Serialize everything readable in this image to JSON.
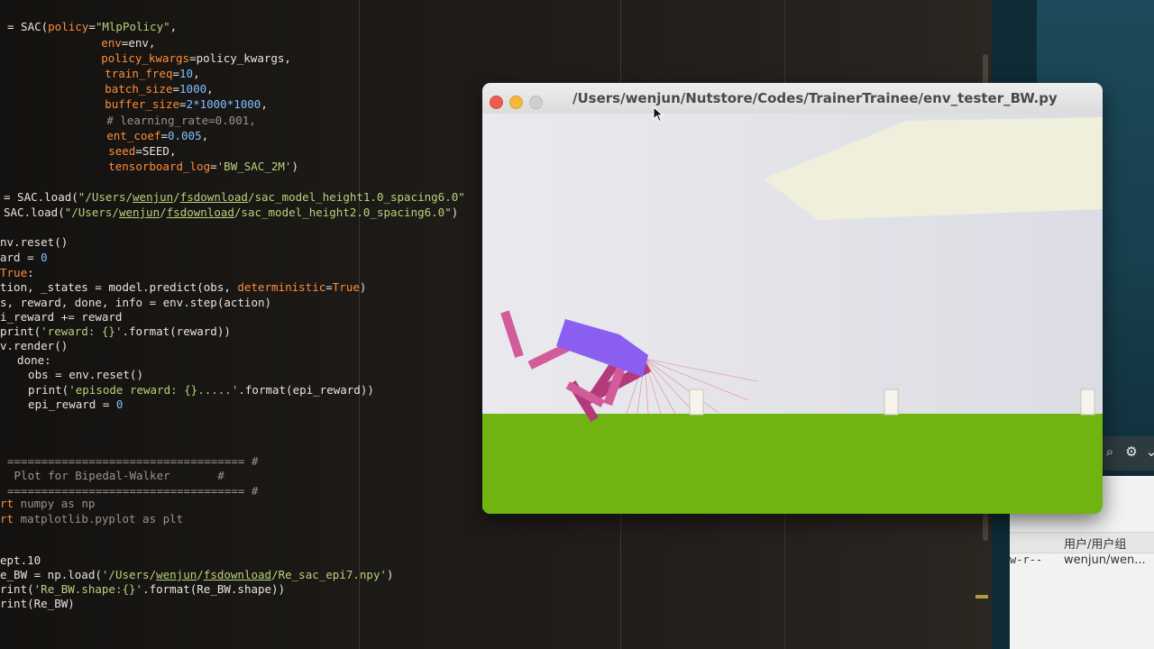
{
  "editor": {
    "lines": [
      [
        [
          "",
          "= SAC("
        ],
        [
          "k",
          "policy"
        ],
        [
          "",
          "="
        ],
        [
          "s",
          "\"MlpPolicy\""
        ],
        [
          "",
          ","
        ]
      ],
      [
        [
          "",
          "        "
        ],
        [
          "k",
          "env"
        ],
        [
          "",
          "=env,"
        ]
      ],
      [
        [
          "",
          "        "
        ],
        [
          "k",
          "policy_kwargs"
        ],
        [
          "",
          "=policy_kwargs,"
        ]
      ],
      [
        [
          "",
          "        "
        ],
        [
          "k",
          "train_freq"
        ],
        [
          "",
          "="
        ],
        [
          "n",
          "10"
        ],
        [
          "",
          ","
        ]
      ],
      [
        [
          "",
          "        "
        ],
        [
          "k",
          "batch_size"
        ],
        [
          "",
          "="
        ],
        [
          "n",
          "1000"
        ],
        [
          "",
          ","
        ]
      ],
      [
        [
          "",
          "        "
        ],
        [
          "k",
          "buffer_size"
        ],
        [
          "",
          "="
        ],
        [
          "n",
          "2*1000*1000"
        ],
        [
          "",
          ","
        ]
      ],
      [
        [
          "",
          "        "
        ],
        [
          "c",
          "# learning_rate=0.001,"
        ]
      ],
      [
        [
          "",
          "        "
        ],
        [
          "k",
          "ent_coef"
        ],
        [
          "",
          "="
        ],
        [
          "n",
          "0.005"
        ],
        [
          "",
          ","
        ]
      ],
      [
        [
          "",
          "        "
        ],
        [
          "k",
          "seed"
        ],
        [
          "",
          "=SEED,"
        ]
      ],
      [
        [
          "",
          "        "
        ],
        [
          "k",
          "tensorboard_log"
        ],
        [
          "",
          "="
        ],
        [
          "s",
          "'BW_SAC_2M'"
        ],
        [
          "",
          ")"
        ]
      ],
      [
        [
          "",
          ""
        ]
      ],
      [
        [
          "",
          "= SAC.load("
        ],
        [
          "s",
          "\"/Users/"
        ],
        [
          "su",
          "wenjun"
        ],
        [
          "s",
          "/"
        ],
        [
          "su",
          "fsdownload"
        ],
        [
          "s",
          "/sac_model_height1.0_spacing6.0\""
        ]
      ],
      [
        [
          "",
          "SAC.load("
        ],
        [
          "s",
          "\"/Users/"
        ],
        [
          "su",
          "wenjun"
        ],
        [
          "s",
          "/"
        ],
        [
          "su",
          "fsdownload"
        ],
        [
          "s",
          "/sac_model_height2.0_spacing6.0\""
        ],
        [
          "",
          ")"
        ]
      ],
      [
        [
          "",
          ""
        ]
      ],
      [
        [
          "",
          "nv.reset()"
        ]
      ],
      [
        [
          "",
          "ard = "
        ],
        [
          "n",
          "0"
        ]
      ],
      [
        [
          "k",
          "True"
        ],
        [
          "",
          ":"
        ]
      ],
      [
        [
          "",
          "tion, _states = model.predict(obs, "
        ],
        [
          "k",
          "deterministic"
        ],
        [
          "",
          "="
        ],
        [
          "k",
          "True"
        ],
        [
          "",
          ")"
        ]
      ],
      [
        [
          "",
          "s, reward, done, info = env.step(action)"
        ]
      ],
      [
        [
          "",
          "i_reward += reward"
        ]
      ],
      [
        [
          "",
          "print("
        ],
        [
          "s",
          "'reward: {}'"
        ],
        [
          "",
          ".format(reward))"
        ]
      ],
      [
        [
          "",
          "v.render()"
        ]
      ],
      [
        [
          "",
          "  done:"
        ]
      ],
      [
        [
          "",
          "  obs = env.reset()"
        ]
      ],
      [
        [
          "",
          "  print("
        ],
        [
          "s",
          "'episode reward: {}.....'"
        ],
        [
          "",
          ".format(epi_reward))"
        ]
      ],
      [
        [
          "",
          "  epi_reward = "
        ],
        [
          "n",
          "0"
        ]
      ],
      [
        [
          "",
          ""
        ]
      ],
      [
        [
          "",
          ""
        ]
      ],
      [
        [
          "c",
          "=================================== #"
        ]
      ],
      [
        [
          "c",
          " Plot for Bipedal-Walker       #"
        ]
      ],
      [
        [
          "c",
          "=================================== #"
        ]
      ],
      [
        [
          "k",
          "rt"
        ],
        [
          "",
          ""
        ],
        [
          "c",
          " numpy as np"
        ]
      ],
      [
        [
          "k",
          "rt"
        ],
        [
          "c",
          " matplotlib.pyplot as plt"
        ]
      ],
      [
        [
          "",
          ""
        ]
      ],
      [
        [
          "",
          ""
        ]
      ],
      [
        [
          "",
          "ept.10"
        ]
      ],
      [
        [
          "",
          "e_BW = np.load("
        ],
        [
          "s",
          "'/Users/"
        ],
        [
          "su",
          "wenjun"
        ],
        [
          "s",
          "/"
        ],
        [
          "su",
          "fsdownload"
        ],
        [
          "s",
          "/Re_sac_epi7.npy'"
        ],
        [
          "",
          ")"
        ]
      ],
      [
        [
          "",
          "rint("
        ],
        [
          "s",
          "'Re_BW.shape:{}'"
        ],
        [
          "",
          ".format(Re_BW.shape))"
        ]
      ],
      [
        [
          "",
          "rint(Re_BW)"
        ]
      ]
    ]
  },
  "window": {
    "title": "/Users/wenjun/Nutstore/Codes/TrainerTrainee/env_tester_BW.py"
  },
  "file_panel": {
    "column_header": "用户/用户组",
    "permissions": "w-r--",
    "owner": "wenjun/wen..."
  },
  "colors": {
    "ground": "#6fb410",
    "sky": "#e4e4ea",
    "hull": "#8a5ef0",
    "leg_front": "#d25c9a",
    "leg_back": "#b23a7a",
    "lidar": "#e0707a"
  }
}
